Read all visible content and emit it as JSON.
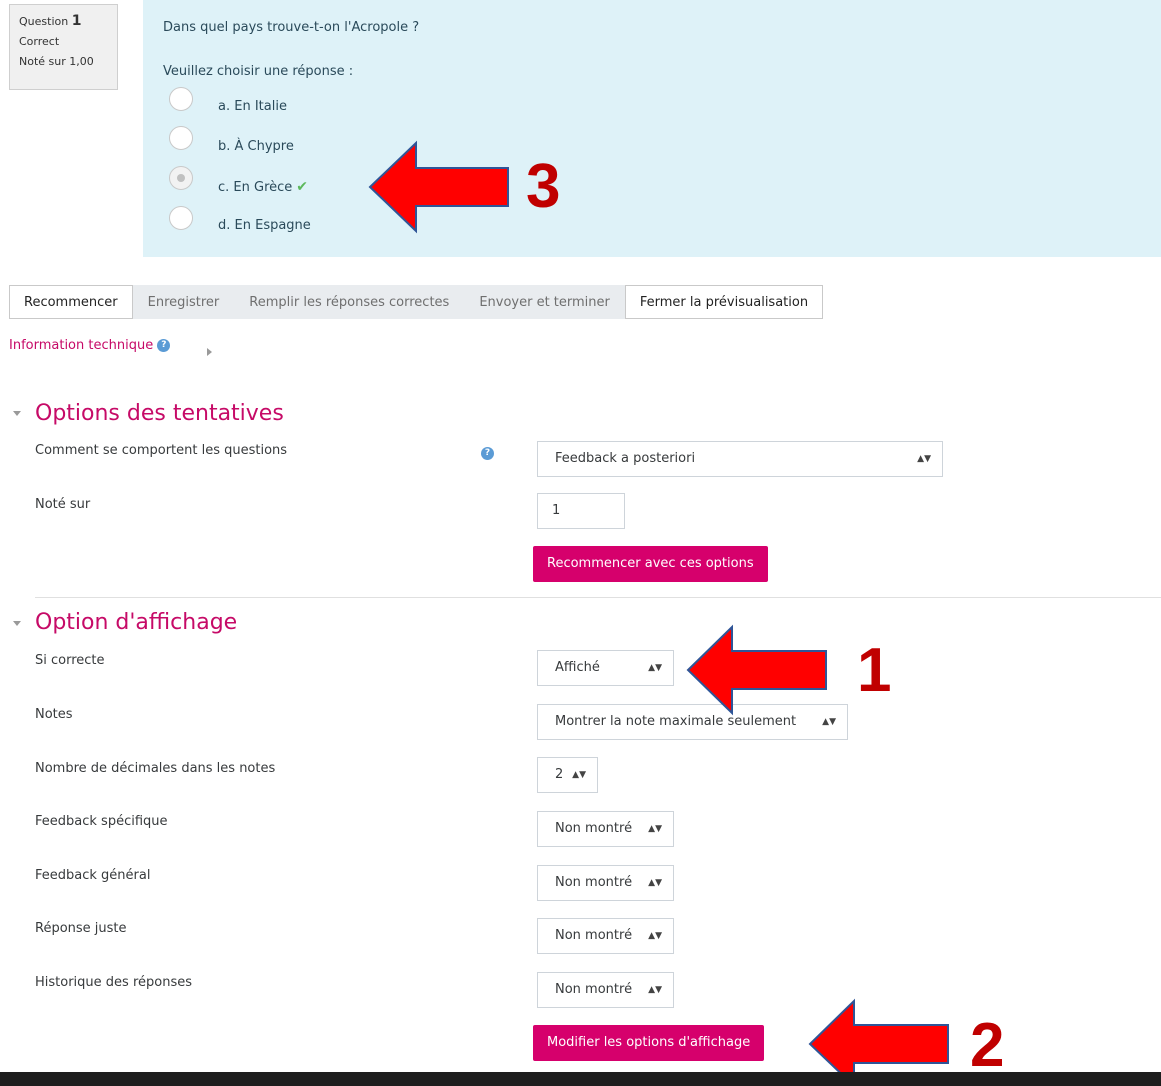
{
  "question_info": {
    "label": "Question",
    "number": "1",
    "state": "Correct",
    "mark": "Noté sur 1,00"
  },
  "question": {
    "text": "Dans quel pays trouve-t-on l'Acropole ?",
    "prompt": "Veuillez choisir une réponse :",
    "answers": [
      {
        "label": "a. En Italie",
        "checked": false
      },
      {
        "label": "b. À Chypre",
        "checked": false
      },
      {
        "label": "c. En Grèce",
        "checked": true,
        "correct": true
      },
      {
        "label": "d. En Espagne",
        "checked": false
      }
    ]
  },
  "buttons": {
    "restart": "Recommencer",
    "save": "Enregistrer",
    "fill_correct": "Remplir les réponses correctes",
    "submit_finish": "Envoyer et terminer",
    "close_preview": "Fermer la prévisualisation"
  },
  "technical_info": "Information technique",
  "attempt_options": {
    "title": "Options des tentatives",
    "behaviour_label": "Comment se comportent les questions",
    "behaviour_value": "Feedback a posteriori",
    "marked_out_of_label": "Noté sur",
    "marked_out_of_value": "1",
    "restart_button": "Recommencer avec ces options"
  },
  "display_options": {
    "title": "Option d'affichage",
    "rows": [
      {
        "label": "Si correcte",
        "value": "Affiché"
      },
      {
        "label": "Notes",
        "value": "Montrer la note maximale seulement"
      },
      {
        "label": "Nombre de décimales dans les notes",
        "value": "2"
      },
      {
        "label": "Feedback spécifique",
        "value": "Non montré"
      },
      {
        "label": "Feedback général",
        "value": "Non montré"
      },
      {
        "label": "Réponse juste",
        "value": "Non montré"
      },
      {
        "label": "Historique des réponses",
        "value": "Non montré"
      }
    ],
    "update_button": "Modifier les options d'affichage"
  },
  "annotations": {
    "marker_1": "1",
    "marker_2": "2",
    "marker_3": "3",
    "arrow_color": "#ff0000"
  },
  "colors": {
    "accent": "#d6006c",
    "question_panel": "#def2f8",
    "link": "#c60a67",
    "correct_tick": "#5cb85c"
  }
}
